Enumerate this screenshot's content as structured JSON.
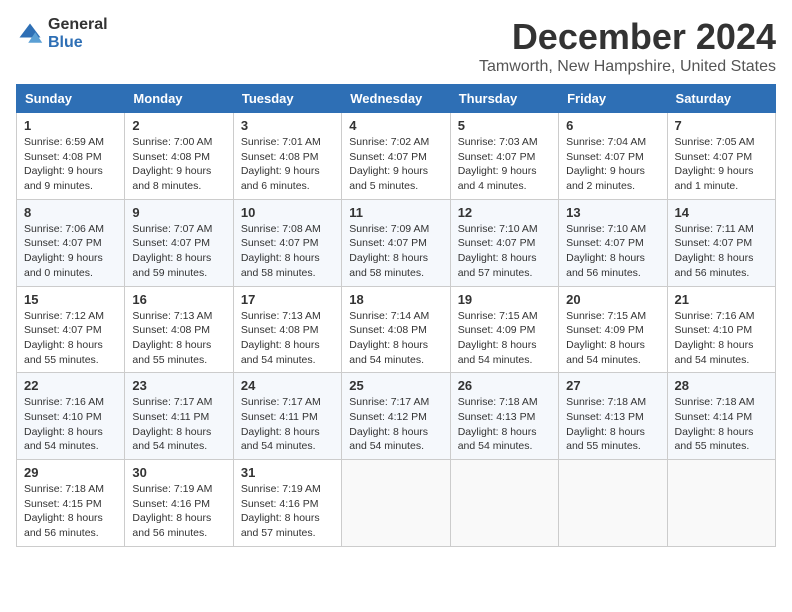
{
  "logo": {
    "general": "General",
    "blue": "Blue"
  },
  "title": {
    "month": "December 2024",
    "location": "Tamworth, New Hampshire, United States"
  },
  "weekdays": [
    "Sunday",
    "Monday",
    "Tuesday",
    "Wednesday",
    "Thursday",
    "Friday",
    "Saturday"
  ],
  "weeks": [
    [
      {
        "day": "1",
        "info": "Sunrise: 6:59 AM\nSunset: 4:08 PM\nDaylight: 9 hours and 9 minutes."
      },
      {
        "day": "2",
        "info": "Sunrise: 7:00 AM\nSunset: 4:08 PM\nDaylight: 9 hours and 8 minutes."
      },
      {
        "day": "3",
        "info": "Sunrise: 7:01 AM\nSunset: 4:08 PM\nDaylight: 9 hours and 6 minutes."
      },
      {
        "day": "4",
        "info": "Sunrise: 7:02 AM\nSunset: 4:07 PM\nDaylight: 9 hours and 5 minutes."
      },
      {
        "day": "5",
        "info": "Sunrise: 7:03 AM\nSunset: 4:07 PM\nDaylight: 9 hours and 4 minutes."
      },
      {
        "day": "6",
        "info": "Sunrise: 7:04 AM\nSunset: 4:07 PM\nDaylight: 9 hours and 2 minutes."
      },
      {
        "day": "7",
        "info": "Sunrise: 7:05 AM\nSunset: 4:07 PM\nDaylight: 9 hours and 1 minute."
      }
    ],
    [
      {
        "day": "8",
        "info": "Sunrise: 7:06 AM\nSunset: 4:07 PM\nDaylight: 9 hours and 0 minutes."
      },
      {
        "day": "9",
        "info": "Sunrise: 7:07 AM\nSunset: 4:07 PM\nDaylight: 8 hours and 59 minutes."
      },
      {
        "day": "10",
        "info": "Sunrise: 7:08 AM\nSunset: 4:07 PM\nDaylight: 8 hours and 58 minutes."
      },
      {
        "day": "11",
        "info": "Sunrise: 7:09 AM\nSunset: 4:07 PM\nDaylight: 8 hours and 58 minutes."
      },
      {
        "day": "12",
        "info": "Sunrise: 7:10 AM\nSunset: 4:07 PM\nDaylight: 8 hours and 57 minutes."
      },
      {
        "day": "13",
        "info": "Sunrise: 7:10 AM\nSunset: 4:07 PM\nDaylight: 8 hours and 56 minutes."
      },
      {
        "day": "14",
        "info": "Sunrise: 7:11 AM\nSunset: 4:07 PM\nDaylight: 8 hours and 56 minutes."
      }
    ],
    [
      {
        "day": "15",
        "info": "Sunrise: 7:12 AM\nSunset: 4:07 PM\nDaylight: 8 hours and 55 minutes."
      },
      {
        "day": "16",
        "info": "Sunrise: 7:13 AM\nSunset: 4:08 PM\nDaylight: 8 hours and 55 minutes."
      },
      {
        "day": "17",
        "info": "Sunrise: 7:13 AM\nSunset: 4:08 PM\nDaylight: 8 hours and 54 minutes."
      },
      {
        "day": "18",
        "info": "Sunrise: 7:14 AM\nSunset: 4:08 PM\nDaylight: 8 hours and 54 minutes."
      },
      {
        "day": "19",
        "info": "Sunrise: 7:15 AM\nSunset: 4:09 PM\nDaylight: 8 hours and 54 minutes."
      },
      {
        "day": "20",
        "info": "Sunrise: 7:15 AM\nSunset: 4:09 PM\nDaylight: 8 hours and 54 minutes."
      },
      {
        "day": "21",
        "info": "Sunrise: 7:16 AM\nSunset: 4:10 PM\nDaylight: 8 hours and 54 minutes."
      }
    ],
    [
      {
        "day": "22",
        "info": "Sunrise: 7:16 AM\nSunset: 4:10 PM\nDaylight: 8 hours and 54 minutes."
      },
      {
        "day": "23",
        "info": "Sunrise: 7:17 AM\nSunset: 4:11 PM\nDaylight: 8 hours and 54 minutes."
      },
      {
        "day": "24",
        "info": "Sunrise: 7:17 AM\nSunset: 4:11 PM\nDaylight: 8 hours and 54 minutes."
      },
      {
        "day": "25",
        "info": "Sunrise: 7:17 AM\nSunset: 4:12 PM\nDaylight: 8 hours and 54 minutes."
      },
      {
        "day": "26",
        "info": "Sunrise: 7:18 AM\nSunset: 4:13 PM\nDaylight: 8 hours and 54 minutes."
      },
      {
        "day": "27",
        "info": "Sunrise: 7:18 AM\nSunset: 4:13 PM\nDaylight: 8 hours and 55 minutes."
      },
      {
        "day": "28",
        "info": "Sunrise: 7:18 AM\nSunset: 4:14 PM\nDaylight: 8 hours and 55 minutes."
      }
    ],
    [
      {
        "day": "29",
        "info": "Sunrise: 7:18 AM\nSunset: 4:15 PM\nDaylight: 8 hours and 56 minutes."
      },
      {
        "day": "30",
        "info": "Sunrise: 7:19 AM\nSunset: 4:16 PM\nDaylight: 8 hours and 56 minutes."
      },
      {
        "day": "31",
        "info": "Sunrise: 7:19 AM\nSunset: 4:16 PM\nDaylight: 8 hours and 57 minutes."
      },
      {
        "day": "",
        "info": ""
      },
      {
        "day": "",
        "info": ""
      },
      {
        "day": "",
        "info": ""
      },
      {
        "day": "",
        "info": ""
      }
    ]
  ]
}
